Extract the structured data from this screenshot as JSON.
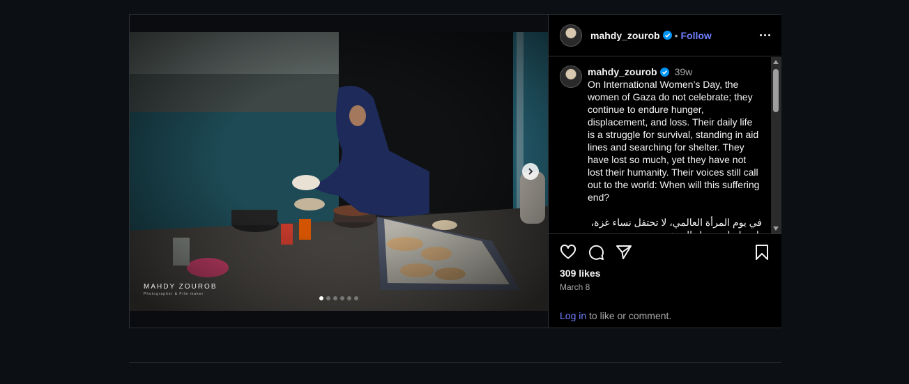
{
  "post": {
    "username": "mahdy_zourob",
    "separator": "•",
    "follow_label": "Follow",
    "caption_time": "39w",
    "caption_en": "On International Women’s Day, the women of Gaza do not celebrate; they continue to endure hunger, displacement, and loss. Their daily life is a struggle for survival, standing in aid lines and searching for shelter. They have lost so much, yet they have not lost their humanity. Their voices still call out to the world: When will this suffering end?",
    "caption_ar": "في يوم المرأة العالمي، لا تحتفل نساء غزة، بل يواصلن تحمل الجوع",
    "likes": "309 likes",
    "date": "March 8",
    "login_link": "Log in",
    "login_suffix": " to like or comment.",
    "watermark_title": "MAHDY ZOUROB",
    "watermark_sub": "Photographer & Film maker",
    "carousel_count": 6,
    "carousel_index": 0
  },
  "colors": {
    "accent": "#6f7ffc",
    "verified": "#0095f6",
    "background": "#0c0f14",
    "border": "#2e3238"
  },
  "icons": [
    "verified-badge-icon",
    "more-options-icon",
    "next-arrow-icon",
    "heart-icon",
    "comment-icon",
    "share-icon",
    "bookmark-icon"
  ]
}
